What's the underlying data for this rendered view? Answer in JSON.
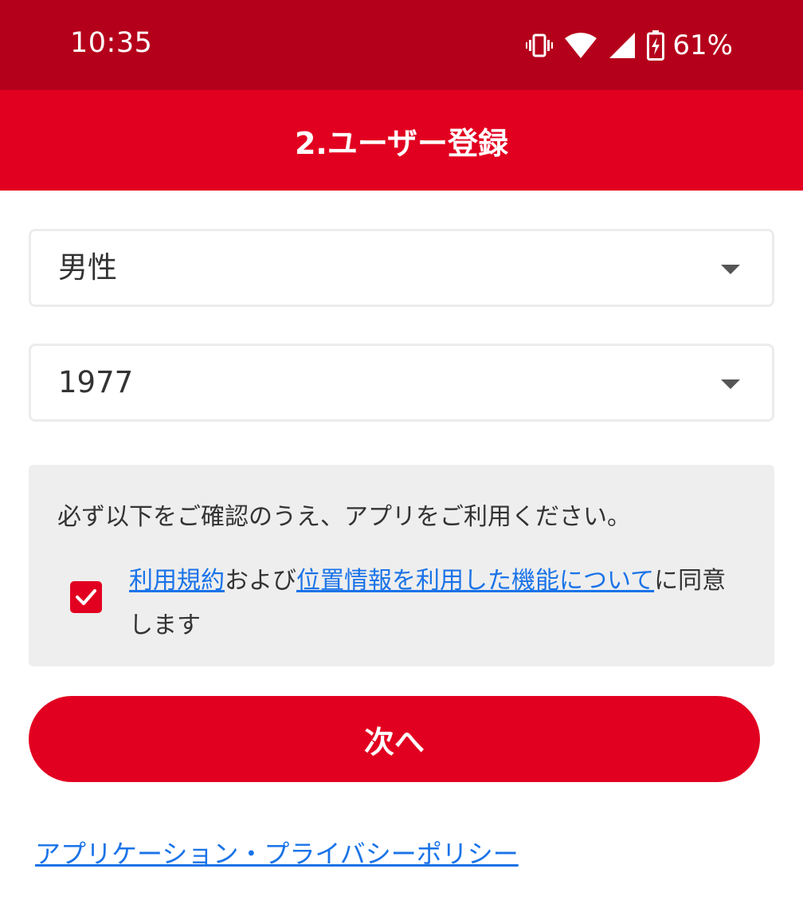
{
  "status_bar": {
    "time": "10:35",
    "battery_percent": "61%",
    "icons": [
      "vibrate-icon",
      "wifi-icon",
      "signal-icon",
      "battery-charging-icon"
    ]
  },
  "app_bar": {
    "title": "2.ユーザー登録"
  },
  "form": {
    "gender_value": "男性",
    "birth_year_value": "1977"
  },
  "notice": {
    "text": "必ず以下をご確認のうえ、アプリをご利用ください。",
    "agree": {
      "checked": true,
      "terms_link": "利用規約",
      "conjunction": "および",
      "location_link": "位置情報を利用した機能について",
      "suffix": "に同意します"
    }
  },
  "next_button": {
    "label": "次へ"
  },
  "privacy_link": {
    "label": "アプリケーション・プライバシーポリシー"
  },
  "colors": {
    "status_bar": "#b5001b",
    "brand_red": "#e20020",
    "link_blue": "#1a73e8",
    "notice_bg": "#eeeeee"
  }
}
